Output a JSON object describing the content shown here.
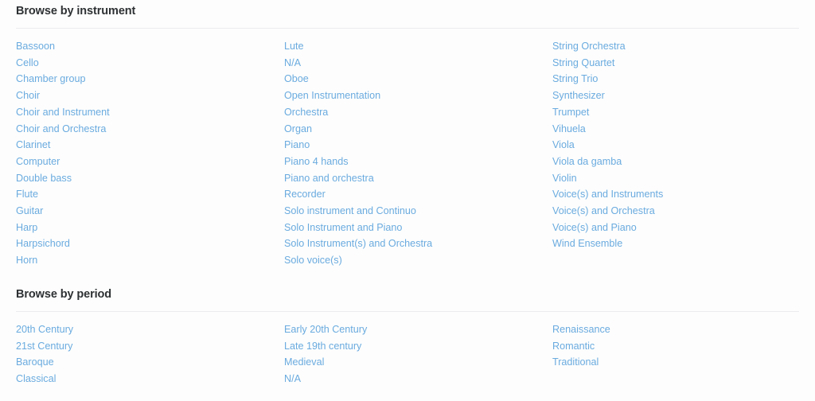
{
  "theme": {
    "background": "#fdfdfd",
    "link_color": "#6aabdf",
    "heading_color": "#2e3133",
    "rule_color": "#ececee"
  },
  "sections": [
    {
      "id": "browse-by-instrument",
      "heading": "Browse by instrument",
      "columns": [
        {
          "items": [
            "Bassoon",
            "Cello",
            "Chamber group",
            "Choir",
            "Choir and Instrument",
            "Choir and Orchestra",
            "Clarinet",
            "Computer",
            "Double bass",
            "Flute",
            "Guitar",
            "Harp",
            "Harpsichord",
            "Horn"
          ]
        },
        {
          "items": [
            "Lute",
            "N/A",
            "Oboe",
            "Open Instrumentation",
            "Orchestra",
            "Organ",
            "Piano",
            "Piano 4 hands",
            "Piano and orchestra",
            "Recorder",
            "Solo instrument and Continuo",
            "Solo Instrument and Piano",
            "Solo Instrument(s) and Orchestra",
            "Solo voice(s)"
          ]
        },
        {
          "items": [
            "String Orchestra",
            "String Quartet",
            "String Trio",
            "Synthesizer",
            "Trumpet",
            "Vihuela",
            "Viola",
            "Viola da gamba",
            "Violin",
            "Voice(s) and Instruments",
            "Voice(s) and Orchestra",
            "Voice(s) and Piano",
            "Wind Ensemble"
          ]
        }
      ]
    },
    {
      "id": "browse-by-period",
      "heading": "Browse by period",
      "columns": [
        {
          "items": [
            "20th Century",
            "21st Century",
            "Baroque",
            "Classical"
          ]
        },
        {
          "items": [
            "Early 20th Century",
            "Late 19th century",
            "Medieval",
            "N/A"
          ]
        },
        {
          "items": [
            "Renaissance",
            "Romantic",
            "Traditional"
          ]
        }
      ]
    }
  ]
}
